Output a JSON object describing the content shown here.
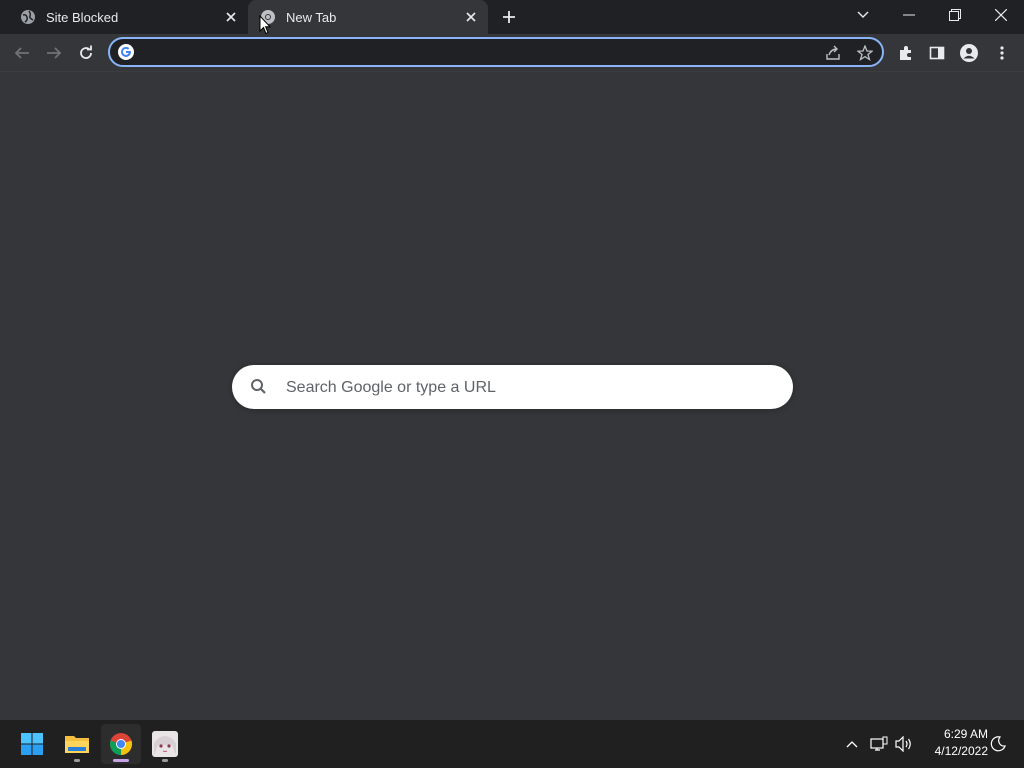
{
  "tabs": [
    {
      "title": "Site Blocked",
      "favicon": "globe-icon",
      "active": false
    },
    {
      "title": "New Tab",
      "favicon": "chrome-icon",
      "active": true
    }
  ],
  "omnibox": {
    "value": "",
    "placeholder": ""
  },
  "search": {
    "placeholder": "Search Google or type a URL"
  },
  "taskbar": {
    "apps": [
      {
        "name": "start-button",
        "icon": "windows-icon"
      },
      {
        "name": "file-explorer",
        "icon": "folder-icon"
      },
      {
        "name": "chrome",
        "icon": "chrome-icon"
      },
      {
        "name": "app-anime-avatar",
        "icon": "avatar-icon"
      }
    ],
    "clock": {
      "time": "6:29 AM",
      "date": "4/12/2022"
    }
  },
  "colors": {
    "tabstrip": "#202124",
    "toolbar": "#35363a",
    "page_bg": "#35363a",
    "omnibox_focus": "#8ab4f8",
    "taskbar": "#202020"
  }
}
